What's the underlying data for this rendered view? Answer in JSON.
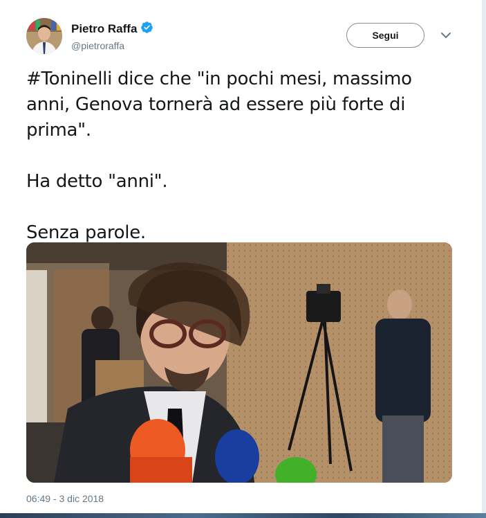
{
  "author": {
    "name": "Pietro Raffa",
    "handle": "@pietroraffa",
    "verified": true
  },
  "actions": {
    "follow_label": "Segui"
  },
  "tweet": {
    "text": "#Toninelli dice che \"in pochi mesi, massimo anni, Genova tornerà ad essere più forte di prima\".\n\nHa detto \"anni\".\n\nSenza parole.",
    "timestamp": "06:49 - 3 dic 2018"
  },
  "colors": {
    "verified_blue": "#1da1f2",
    "meta_gray": "#657786",
    "text": "#14171a"
  }
}
